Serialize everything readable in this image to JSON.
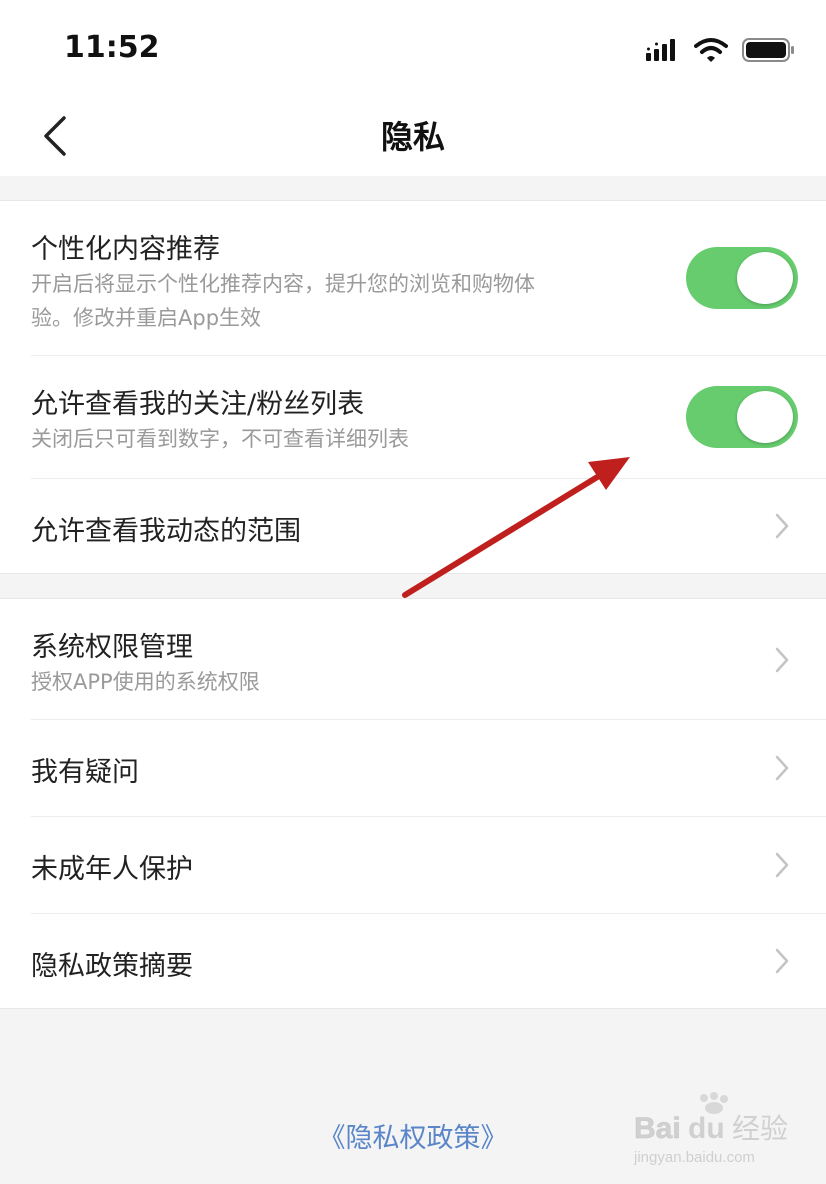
{
  "status_bar": {
    "time": "11:52",
    "icons": [
      "signal-icon",
      "wifi-icon",
      "battery-icon"
    ]
  },
  "nav": {
    "title": "隐私",
    "back_icon": "back-chevron-icon"
  },
  "group1": {
    "personalized": {
      "title": "个性化内容推荐",
      "desc_line1": "开启后将显示个性化推荐内容，提升您的浏览和购物体",
      "desc_line2": "验。修改并重启App生效",
      "enabled": true
    },
    "followers": {
      "title": "允许查看我的关注/粉丝列表",
      "desc": "关闭后只可看到数字，不可查看详细列表",
      "enabled": true
    },
    "moments_range": {
      "title": "允许查看我动态的范围"
    }
  },
  "group2": {
    "system_permissions": {
      "title": "系统权限管理",
      "desc": "授权APP使用的系统权限"
    },
    "questions": {
      "title": "我有疑问"
    },
    "minor_protection": {
      "title": "未成年人保护"
    },
    "policy_summary": {
      "title": "隐私政策摘要"
    }
  },
  "footer": {
    "policy_link": "《隐私权政策》"
  },
  "watermark": {
    "brand": "Baidu经验",
    "url": "jingyan.baidu.com"
  },
  "colors": {
    "toggle_on": "#66cc6e",
    "link": "#5a86c9",
    "annotation_arrow": "#c0201d"
  }
}
